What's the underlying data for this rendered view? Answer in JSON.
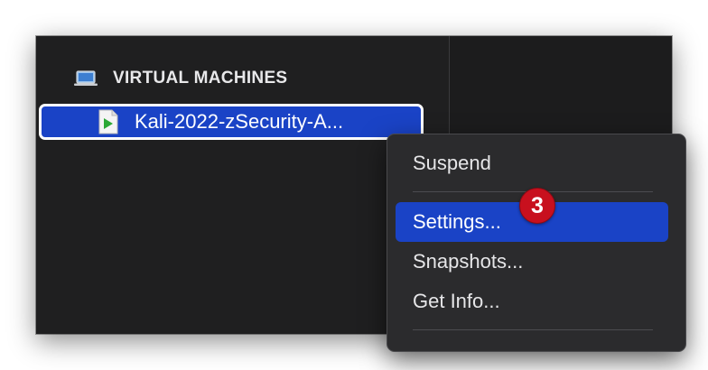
{
  "sidebar": {
    "section_icon": "laptop-icon",
    "section_title": "VIRTUAL MACHINES",
    "vm": {
      "icon": "vm-play-icon",
      "name": "Kali-2022-zSecurity-A..."
    }
  },
  "context_menu": {
    "items": [
      {
        "label": "Suspend",
        "selected": false
      },
      {
        "label": "Settings...",
        "selected": true
      },
      {
        "label": "Snapshots...",
        "selected": false
      },
      {
        "label": "Get Info...",
        "selected": false
      }
    ]
  },
  "annotation": {
    "step": "3"
  },
  "colors": {
    "selection": "#1a43c6",
    "window_bg": "#1e1e1f",
    "menu_bg": "#2b2b2d",
    "badge": "#c8101e",
    "play_green": "#2ba835"
  }
}
